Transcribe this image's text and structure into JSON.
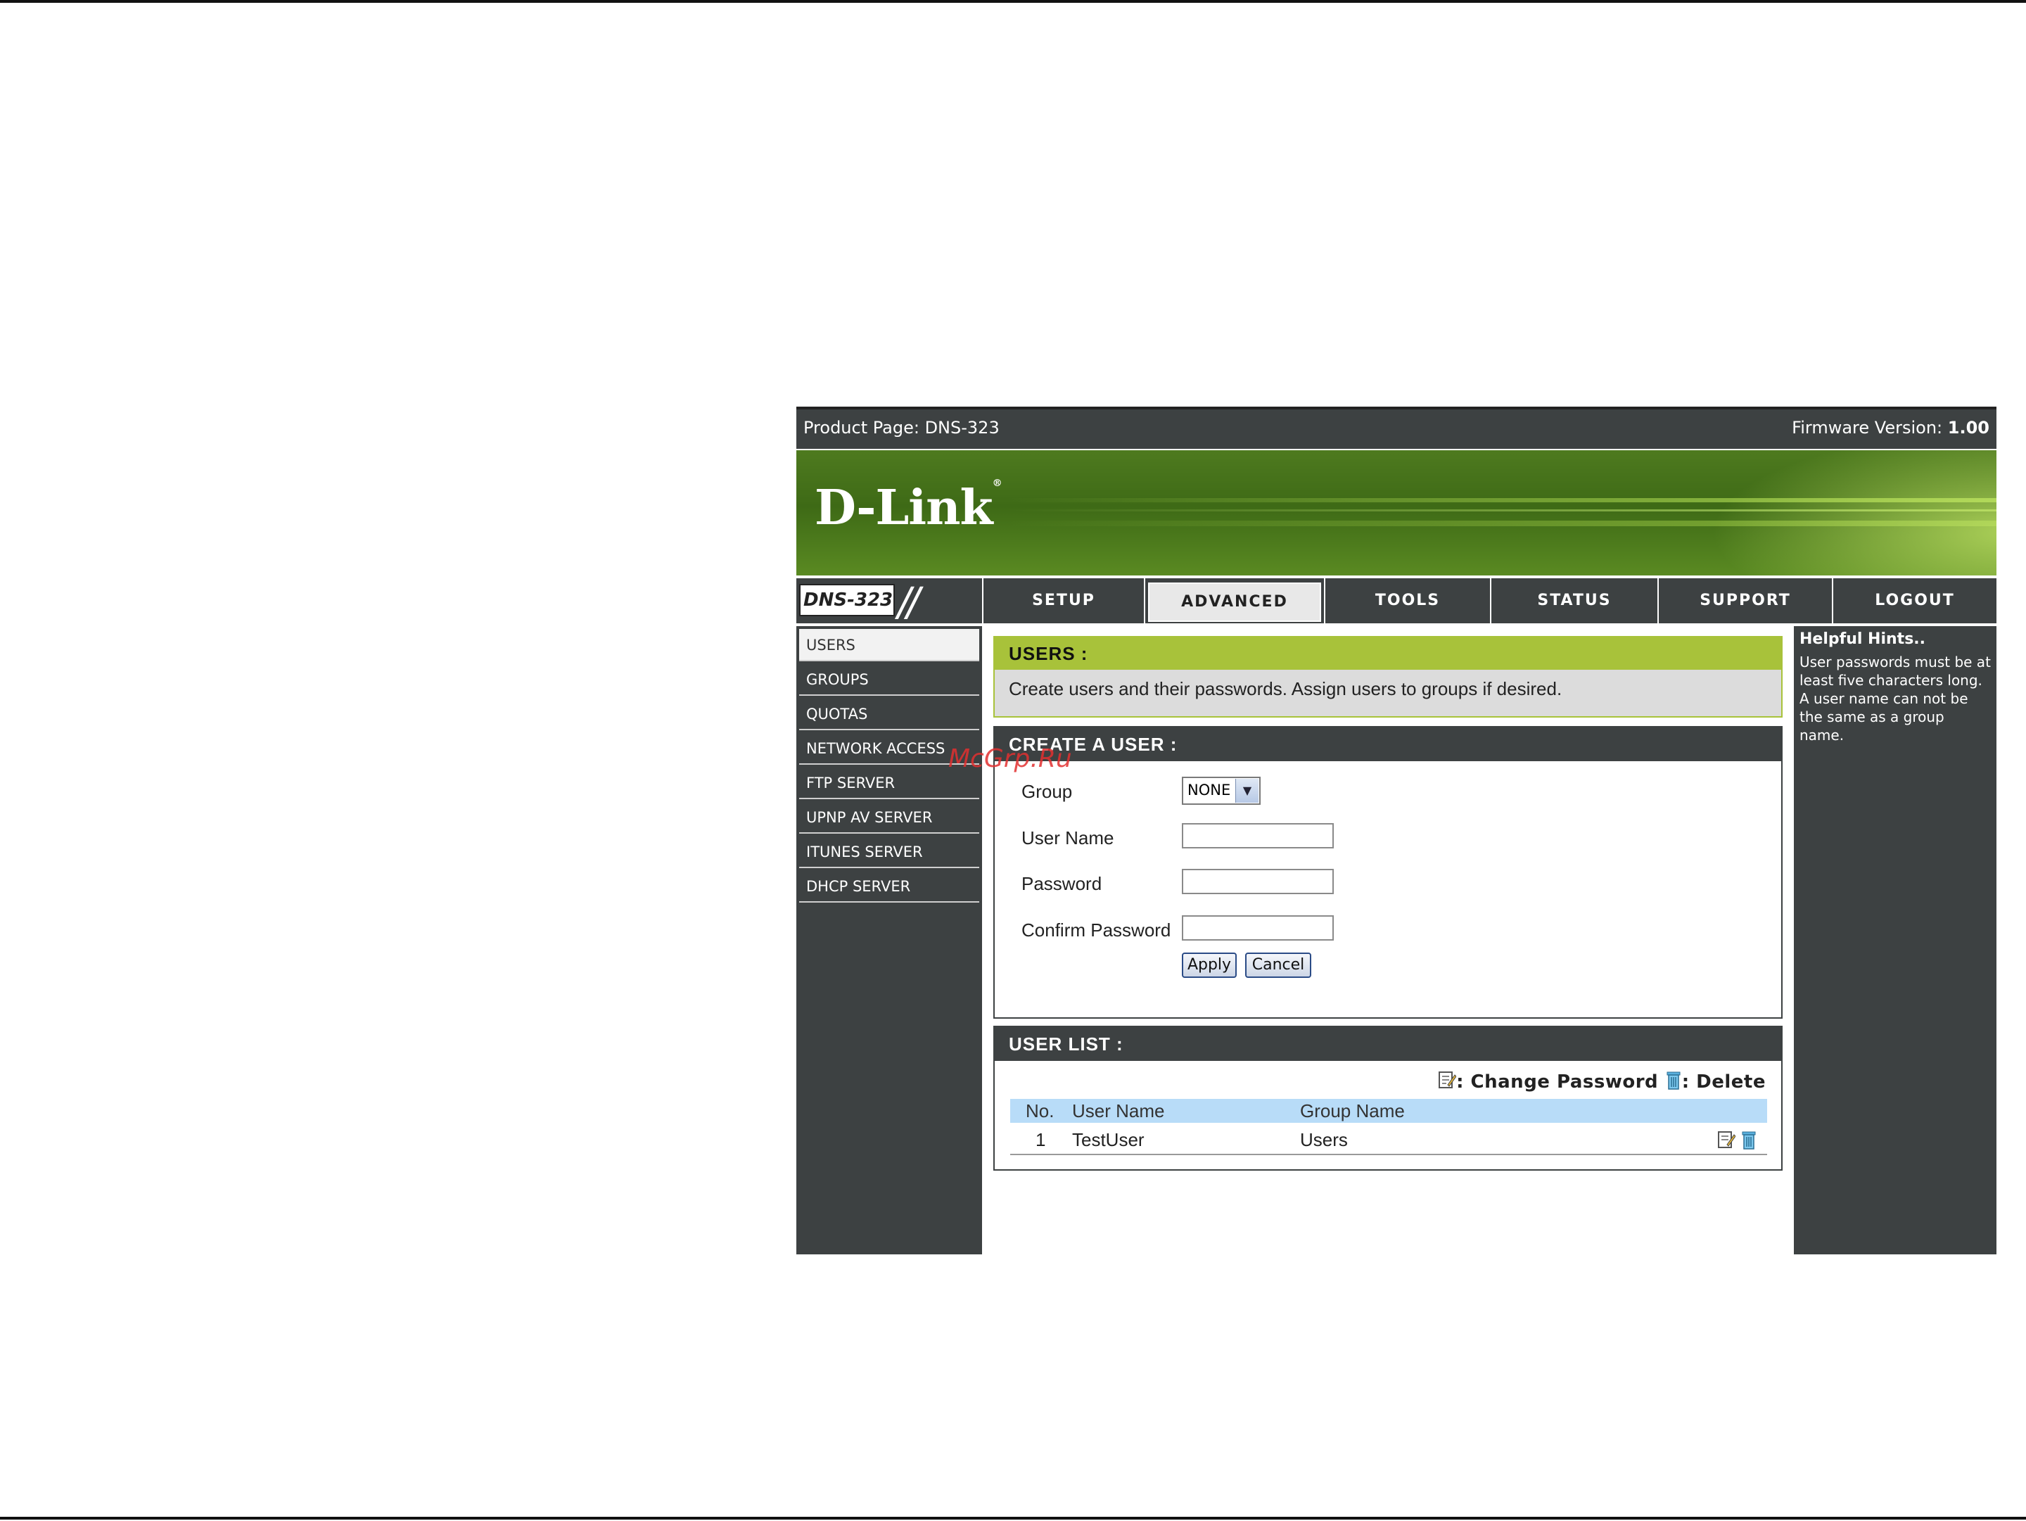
{
  "header": {
    "product_page": "Product Page: DNS-323",
    "firmware_label": "Firmware Version:",
    "firmware_version": "1.00"
  },
  "banner": {
    "brand": "D-Link"
  },
  "nav": {
    "model": "DNS-323",
    "tabs": [
      {
        "label": "SETUP"
      },
      {
        "label": "ADVANCED",
        "active": true
      },
      {
        "label": "TOOLS"
      },
      {
        "label": "STATUS"
      },
      {
        "label": "SUPPORT"
      },
      {
        "label": "LOGOUT"
      }
    ]
  },
  "sidebar": {
    "items": [
      {
        "label": "USERS",
        "active": true
      },
      {
        "label": "GROUPS"
      },
      {
        "label": "QUOTAS"
      },
      {
        "label": "NETWORK ACCESS"
      },
      {
        "label": "FTP SERVER"
      },
      {
        "label": "UPNP AV SERVER"
      },
      {
        "label": "ITUNES SERVER"
      },
      {
        "label": "DHCP SERVER"
      }
    ]
  },
  "users_section": {
    "title": "USERS :",
    "description": "Create users and their passwords. Assign users to groups if desired."
  },
  "create_user": {
    "title": "CREATE A USER :",
    "group_label": "Group",
    "group_value": "NONE",
    "username_label": "User Name",
    "password_label": "Password",
    "confirm_label": "Confirm Password",
    "username_value": "",
    "password_value": "",
    "confirm_value": "",
    "apply_label": "Apply",
    "cancel_label": "Cancel"
  },
  "user_list": {
    "title": "USER LIST :",
    "legend_change": ": Change Password",
    "legend_delete": ": Delete",
    "columns": [
      "No.",
      "User Name",
      "Group Name"
    ],
    "rows": [
      {
        "no": "1",
        "user": "TestUser",
        "group": "Users"
      }
    ]
  },
  "hints": {
    "title": "Helpful Hints..",
    "text": "User passwords must be at least five characters long. A user name can not be the same as a group name."
  },
  "watermark": "McGrp.Ru",
  "colors": {
    "dark": "#3d4142",
    "green_header": "#a8c23a",
    "table_header": "#b8dcf8"
  }
}
